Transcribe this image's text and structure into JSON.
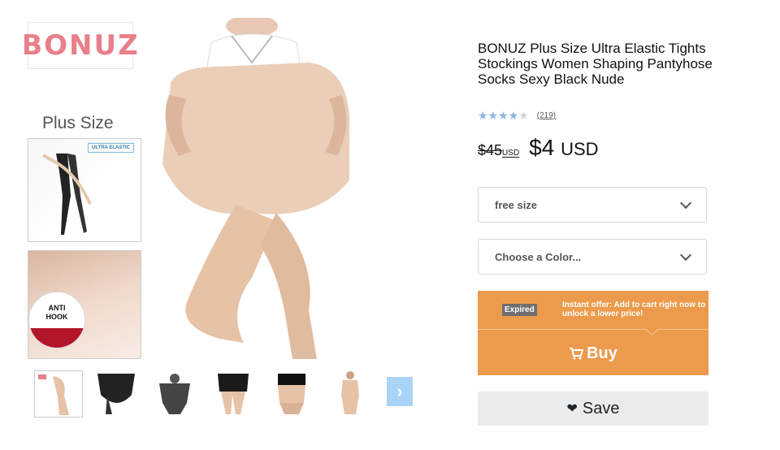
{
  "gallery": {
    "brand_logo": "BONUZ",
    "badge_text": "Plus Size",
    "inset_label": "ULTRA ELASTIC",
    "anti_hook_line1": "ANTI",
    "anti_hook_line2": "HOOK",
    "thumbnail_count": 6,
    "next_icon": "chevron-right-icon"
  },
  "product": {
    "title": "BONUZ Plus Size Ultra Elastic Tights Stockings Women Shaping Pantyhose Socks Sexy Black Nude",
    "rating": {
      "stars": 4,
      "max": 5,
      "count_label": "(219)"
    },
    "price": {
      "old": "$45",
      "old_currency": "USD",
      "new": "$4",
      "new_currency": "USD"
    }
  },
  "options": {
    "size_selected": "free size",
    "color_placeholder": "Choose a Color..."
  },
  "offer": {
    "expired_label": "Expired",
    "text": "Instant offer: Add to cart right now to unlock a lower price!",
    "buy_label": "Buy",
    "buy_icon": "cart-icon"
  },
  "save": {
    "label": "Save",
    "icon": "heart-icon"
  },
  "colors": {
    "accent_orange": "#ec9a4c",
    "star_blue": "#8ab4e8",
    "next_button": "#a9d3f7",
    "brand_pink": "#e87f8a",
    "save_bg": "#e9ecef"
  }
}
